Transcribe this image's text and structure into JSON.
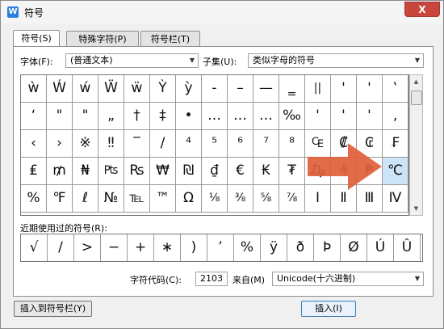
{
  "window": {
    "title": "符号",
    "app_icon": "W",
    "close_label": "X"
  },
  "tabs": [
    "符号(S)",
    "特殊字符(P)",
    "符号栏(T)"
  ],
  "font": {
    "label": "字体(F):",
    "value": "(普通文本)"
  },
  "subset": {
    "label": "子集(U):",
    "value": "类似字母的符号"
  },
  "symbol_rows": [
    [
      "ẁ",
      "Ẃ",
      "ẃ",
      "Ẅ",
      "ẅ",
      "Ỳ",
      "ỳ",
      "‐",
      "–",
      "—",
      "‗",
      "||",
      "'",
      "'",
      "‛"
    ],
    [
      "‘",
      "\"",
      "\"",
      "„",
      "†",
      "‡",
      "•",
      "…",
      "…",
      "…",
      "‰",
      "'",
      "'",
      "'",
      "‚"
    ],
    [
      "‹",
      "›",
      "※",
      "‼",
      "‾",
      "/",
      "⁴",
      "⁵",
      "⁶",
      "⁷",
      "⁸",
      "₠",
      "₡",
      "₢",
      "₣"
    ],
    [
      "₤",
      "₥",
      "₦",
      "₧",
      "₨",
      "₩",
      "₪",
      "₫",
      "€",
      "₭",
      "₮",
      "₯",
      "₰",
      "₱",
      "℃"
    ],
    [
      "%",
      "℉",
      "ℓ",
      "№",
      "℡",
      "™",
      "Ω",
      "⅛",
      "⅜",
      "⅝",
      "⅞",
      "Ⅰ",
      "Ⅱ",
      "Ⅲ",
      "Ⅳ"
    ]
  ],
  "selected_symbol": "℃",
  "recent": {
    "label": "近期使用过的符号(R):",
    "symbols": [
      "√",
      "/",
      ">",
      "−",
      "+",
      "∗",
      ")",
      "’",
      "%",
      "ÿ",
      "ð",
      "Þ",
      "Ø",
      "Ú",
      "Û"
    ]
  },
  "char_code": {
    "label": "字符代码(C):",
    "value": "2103",
    "from_label": "来自(M)",
    "from_value": "Unicode(十六进制)"
  },
  "buttons": {
    "insert_to_bar": "插入到符号栏(Y)",
    "insert": "插入(I)"
  },
  "colors": {
    "arrow": "#e0603a",
    "selection": "#cde3f7"
  }
}
